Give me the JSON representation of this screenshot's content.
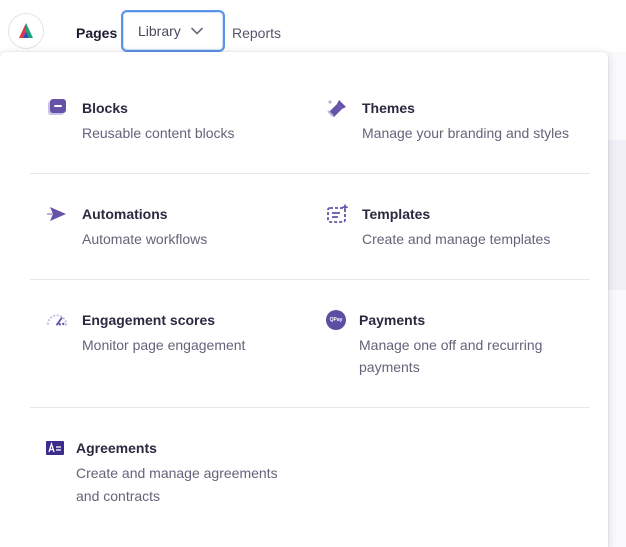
{
  "nav": {
    "pages": "Pages",
    "library": "Library",
    "reports": "Reports",
    "logo_icon": "brand-logo-icon",
    "chevron_icon": "chevron-down-icon"
  },
  "colors": {
    "accent": "#5b4fa3",
    "focus_ring": "#5b93e6"
  },
  "menu": {
    "blocks": {
      "title": "Blocks",
      "desc": "Reusable content blocks",
      "icon": "blocks-icon"
    },
    "themes": {
      "title": "Themes",
      "desc": "Manage your branding and styles",
      "icon": "paintbrush-icon"
    },
    "automations": {
      "title": "Automations",
      "desc": "Automate workflows",
      "icon": "automation-icon"
    },
    "templates": {
      "title": "Templates",
      "desc": "Create and manage templates",
      "icon": "templates-icon"
    },
    "engagement": {
      "title": "Engagement scores",
      "desc": "Monitor page engagement",
      "icon": "gauge-icon"
    },
    "payments": {
      "title": "Payments",
      "desc_line1": "Manage one off and recurring",
      "desc_line2": "payments",
      "icon": "payments-icon",
      "badge": "QPay"
    },
    "agreements": {
      "title": "Agreements",
      "desc_line1": "Create and manage agreements",
      "desc_line2": "and contracts",
      "icon": "agreements-icon"
    }
  }
}
